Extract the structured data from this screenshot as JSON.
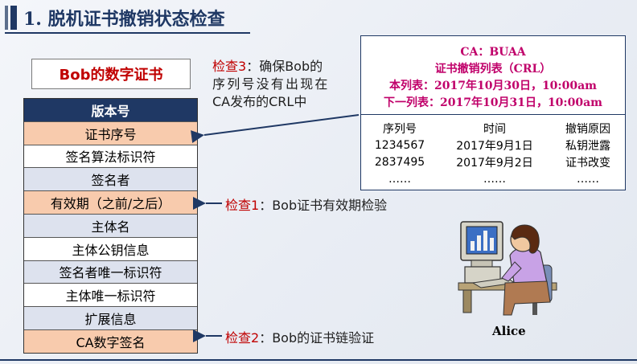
{
  "title": "1. 脱机证书撤销状态检查",
  "certificate": {
    "title": "Bob的数字证书",
    "fields": [
      {
        "label": "版本号",
        "style": "header"
      },
      {
        "label": "证书序号",
        "style": "hl"
      },
      {
        "label": "签名算法标识符",
        "style": "wh"
      },
      {
        "label": "签名者",
        "style": "alt"
      },
      {
        "label": "有效期（之前/之后）",
        "style": "hl"
      },
      {
        "label": "主体名",
        "style": "alt"
      },
      {
        "label": "主体公钥信息",
        "style": "wh"
      },
      {
        "label": "签名者唯一标识符",
        "style": "alt"
      },
      {
        "label": "主体唯一标识符",
        "style": "wh"
      },
      {
        "label": "扩展信息",
        "style": "alt"
      },
      {
        "label": "CA数字签名",
        "style": "hl"
      }
    ]
  },
  "checks": {
    "check3_prefix": "检查3",
    "check3_line1": "：确保Bob的",
    "check3_line2": "序列号没有出现在",
    "check3_line3": "CA发布的CRL中",
    "check1_prefix": "检查1",
    "check1_text": "：Bob证书有效期检验",
    "check2_prefix": "检查2",
    "check2_text": "：Bob的证书链验证"
  },
  "crl": {
    "ca": "CA：BUAA",
    "name": "证书撤销列表（CRL）",
    "this_update": "本列表：2017年10月30日，10:00am",
    "next_update": "下一列表：2017年10月31日，10:00am",
    "columns": [
      "序列号",
      "时间",
      "撤销原因"
    ],
    "rows": [
      [
        "1234567",
        "2017年9月1日",
        "私钥泄露"
      ],
      [
        "2837495",
        "2017年9月2日",
        "证书改变"
      ],
      [
        "……",
        "……",
        "……"
      ]
    ]
  },
  "alice": {
    "name": "Alice"
  },
  "colors": {
    "navy": "#1f3864",
    "highlight": "#f8cbad",
    "red": "#c00000",
    "magenta": "#c0006a"
  }
}
